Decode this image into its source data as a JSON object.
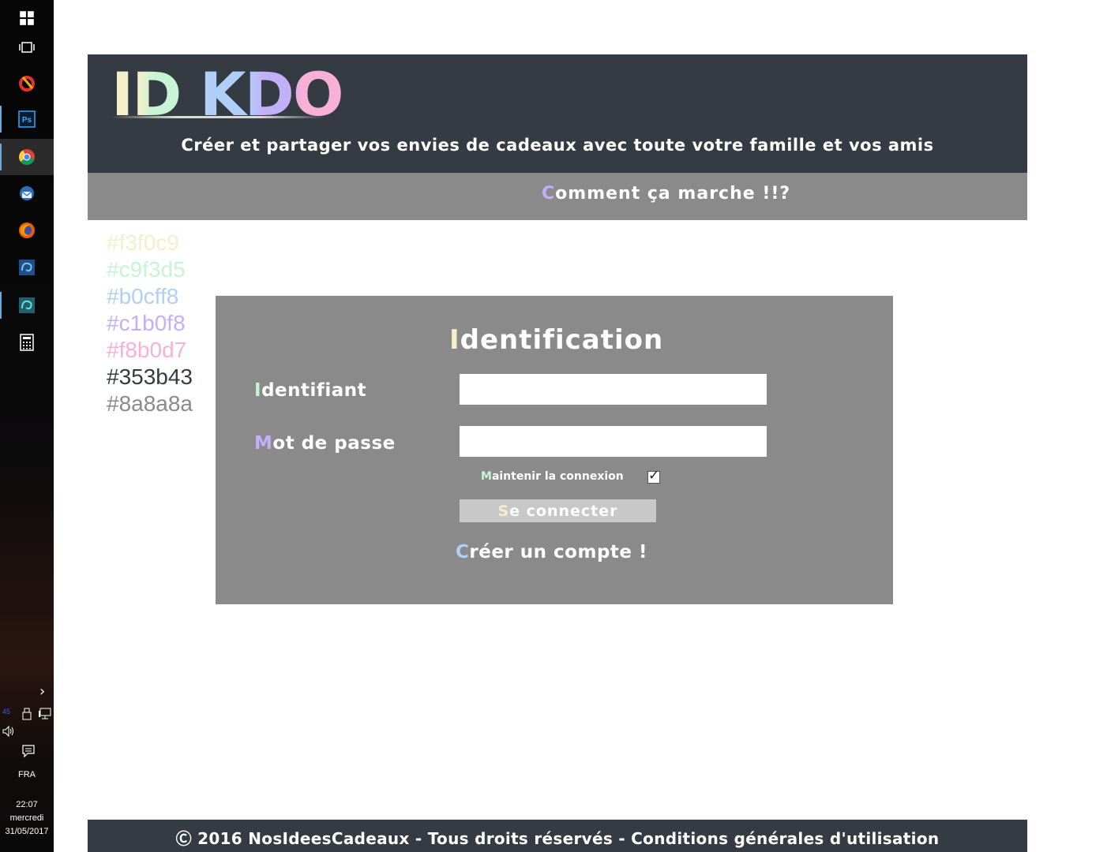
{
  "taskbar": {
    "apps": [
      "windows-start",
      "task-view",
      "ccleaner",
      "photoshop",
      "chrome",
      "thunderbird",
      "firefox",
      "app-blue-swirl",
      "app-teal-swirl",
      "calculator"
    ],
    "tray": {
      "chevron": "›",
      "temp": "45",
      "lang": "FRA",
      "time": "22:07",
      "day": "mercredi",
      "date": "31/05/2017"
    }
  },
  "header": {
    "logo": {
      "part1": "ID",
      "part2": "KDO"
    },
    "tagline": "Créer et partager vos envies de cadeaux avec toute votre famille et vos amis"
  },
  "nav": {
    "first": "C",
    "rest": "omment ça marche !!?"
  },
  "palette": [
    {
      "label": "#f3f0c9",
      "color": "#f3f0c9"
    },
    {
      "label": "#c9f3d5",
      "color": "#c9f3d5"
    },
    {
      "label": "#b0cff8",
      "color": "#b0cff8"
    },
    {
      "label": "#c1b0f8",
      "color": "#c1b0f8"
    },
    {
      "label": "#f8b0d7",
      "color": "#f8b0d7"
    },
    {
      "label": "#353b43",
      "color": "#353b43"
    },
    {
      "label": "#8a8a8a",
      "color": "#8a8a8a"
    }
  ],
  "login": {
    "title": {
      "first": "I",
      "rest": "dentification"
    },
    "username": {
      "first": "I",
      "rest": "dentifiant",
      "value": ""
    },
    "password": {
      "first": "M",
      "rest": "ot de passe",
      "value": ""
    },
    "remember": {
      "first": "M",
      "rest": "aintenir la connexion",
      "checked": true
    },
    "submit": {
      "first": "S",
      "rest": "e connecter"
    },
    "create": {
      "first": "C",
      "rest": "réer un compte !"
    }
  },
  "footer": {
    "text": "Ⓒ 2016 NosIdeesCadeaux - Tous droits réservés - Conditions générales d'utilisation"
  }
}
